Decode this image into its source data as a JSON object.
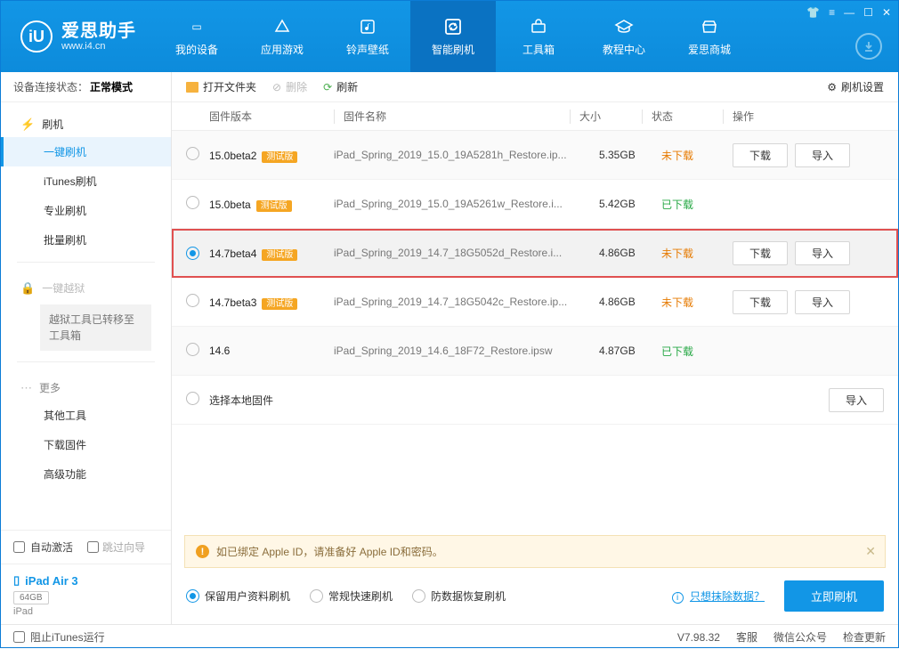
{
  "brand": {
    "title": "爱思助手",
    "subtitle": "www.i4.cn"
  },
  "nav": {
    "items": [
      {
        "label": "我的设备"
      },
      {
        "label": "应用游戏"
      },
      {
        "label": "铃声壁纸"
      },
      {
        "label": "智能刷机"
      },
      {
        "label": "工具箱"
      },
      {
        "label": "教程中心"
      },
      {
        "label": "爱思商城"
      }
    ]
  },
  "sidebar": {
    "status_label": "设备连接状态：",
    "status_value": "正常模式",
    "flash_section": "刷机",
    "flash_items": [
      "一键刷机",
      "iTunes刷机",
      "专业刷机",
      "批量刷机"
    ],
    "jailbreak_section": "一键越狱",
    "jailbreak_note": "越狱工具已转移至工具箱",
    "more_section": "更多",
    "more_items": [
      "其他工具",
      "下载固件",
      "高级功能"
    ],
    "auto_activate": "自动激活",
    "skip_guide": "跳过向导",
    "device": {
      "name": "iPad Air 3",
      "storage": "64GB",
      "type": "iPad"
    }
  },
  "toolbar": {
    "open_folder": "打开文件夹",
    "delete": "删除",
    "refresh": "刷新",
    "settings": "刷机设置"
  },
  "table": {
    "headers": {
      "version": "固件版本",
      "name": "固件名称",
      "size": "大小",
      "status": "状态",
      "ops": "操作"
    },
    "beta_badge": "测试版",
    "btn_download": "下载",
    "btn_import": "导入",
    "status_not_downloaded": "未下载",
    "status_downloaded": "已下载",
    "rows": [
      {
        "version": "15.0beta2",
        "beta": true,
        "name": "iPad_Spring_2019_15.0_19A5281h_Restore.ip...",
        "size": "5.35GB",
        "status": "nd",
        "ops": true
      },
      {
        "version": "15.0beta",
        "beta": true,
        "name": "iPad_Spring_2019_15.0_19A5261w_Restore.i...",
        "size": "5.42GB",
        "status": "dl",
        "ops": false
      },
      {
        "version": "14.7beta4",
        "beta": true,
        "name": "iPad_Spring_2019_14.7_18G5052d_Restore.i...",
        "size": "4.86GB",
        "status": "nd",
        "ops": true,
        "selected": true,
        "highlight": true
      },
      {
        "version": "14.7beta3",
        "beta": true,
        "name": "iPad_Spring_2019_14.7_18G5042c_Restore.ip...",
        "size": "4.86GB",
        "status": "nd",
        "ops": true
      },
      {
        "version": "14.6",
        "beta": false,
        "name": "iPad_Spring_2019_14.6_18F72_Restore.ipsw",
        "size": "4.87GB",
        "status": "dl",
        "ops": false
      }
    ],
    "local_firmware": "选择本地固件"
  },
  "notice": "如已绑定 Apple ID，请准备好 Apple ID和密码。",
  "action": {
    "opt1": "保留用户资料刷机",
    "opt2": "常规快速刷机",
    "opt3": "防数据恢复刷机",
    "link": "只想抹除数据？",
    "primary": "立即刷机"
  },
  "statusbar": {
    "block_itunes": "阻止iTunes运行",
    "version": "V7.98.32",
    "service": "客服",
    "wechat": "微信公众号",
    "update": "检查更新"
  }
}
